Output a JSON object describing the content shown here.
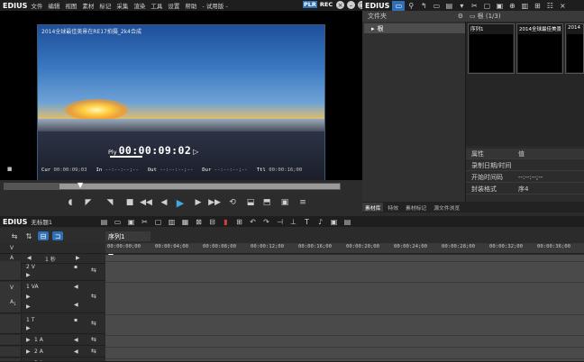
{
  "app": {
    "brand": "EDIUS",
    "menus": [
      "文件",
      "编辑",
      "视图",
      "素材",
      "标记",
      "采集",
      "渲染",
      "工具",
      "设置",
      "帮助",
      "- 试用版 -"
    ],
    "plr": "PLR",
    "rec": "REC"
  },
  "player": {
    "video_title": "2014全球最佳美景在RE17拍摄_2k4合成",
    "ply_label": "Ply",
    "ply_timecode": "00:00:09:02",
    "ply_indicator": "▷",
    "cur_label": "Cur",
    "cur_value": "00:00:09;03",
    "in_label": "In",
    "in_value": "--:--:--;--",
    "out_label": "Out",
    "out_value": "--:--:--;--",
    "dur_label": "Dur",
    "dur_value": "--:--:--;--",
    "ttl_label": "Ttl",
    "ttl_value": "00:00:16;00"
  },
  "right_panel": {
    "brand": "EDIUS",
    "folder_header": "文件夹",
    "root_label": "根",
    "bin_header": "根 (1/3)",
    "clips": [
      {
        "label": "序列1"
      },
      {
        "label": "2014全球最佳美景"
      },
      {
        "label": "2014"
      }
    ],
    "props_header_k": "属性",
    "props_header_v": "值",
    "props": [
      {
        "k": "录制日期/时间",
        "v": ""
      },
      {
        "k": "开始时间码",
        "v": "--:--:--;--"
      },
      {
        "k": "封装格式",
        "v": "序4"
      }
    ],
    "tabs": [
      "素材库",
      "特效",
      "素材标记",
      "源文件浏览"
    ]
  },
  "timeline": {
    "brand": "EDIUS",
    "project": "无标题1",
    "sequence_tab": "序列1",
    "zoom_label": "1 秒",
    "ticks": [
      "00:00:00;00",
      "00:00:04;00",
      "00:00:08;00",
      "00:00:12;00",
      "00:00:16;00",
      "00:00:20;00",
      "00:00:24;00",
      "00:00:28;00",
      "00:00:32;00",
      "00:00:36;00"
    ],
    "tracks": [
      {
        "chan": "",
        "label": "2 V"
      },
      {
        "chan": "V",
        "label": "1 VA"
      },
      {
        "chan": "",
        "label": "1 T"
      },
      {
        "chan": "",
        "label": "1 A"
      },
      {
        "chan": "",
        "label": "2 A"
      },
      {
        "chan": "",
        "label": "3 A"
      }
    ],
    "chan_v": "V",
    "chan_a": "A"
  }
}
